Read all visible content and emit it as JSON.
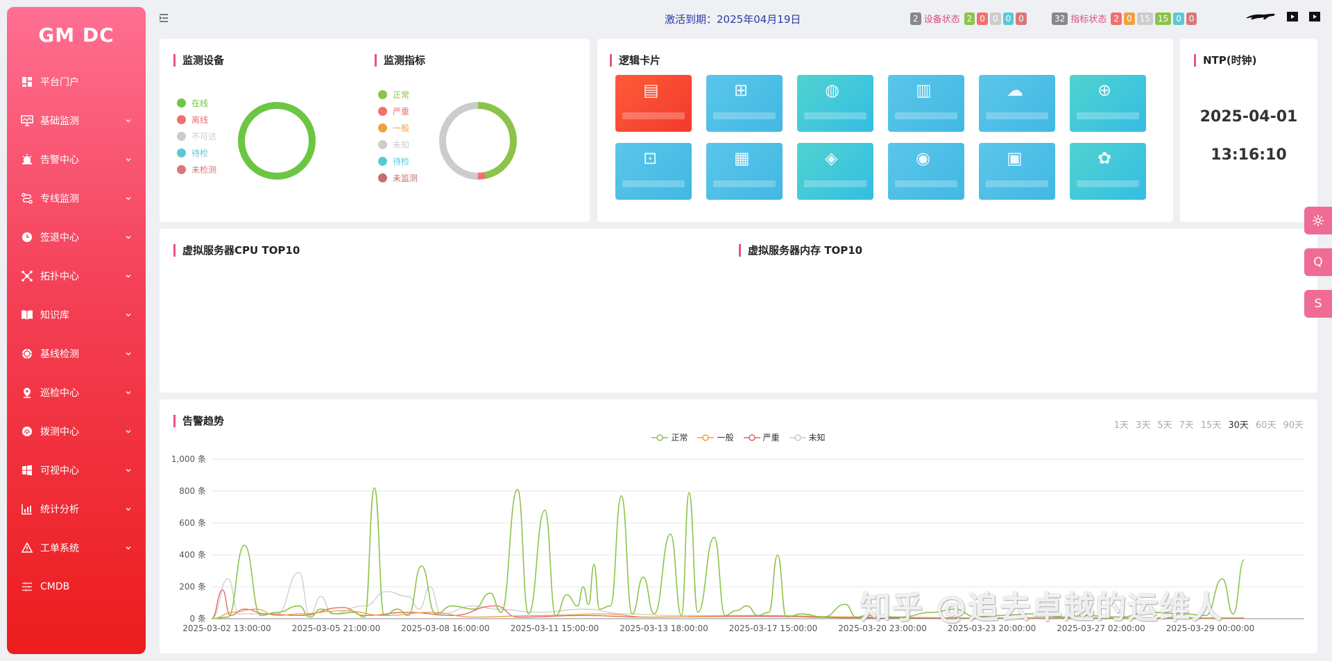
{
  "app": {
    "brand": "GM DC"
  },
  "sidebar": {
    "items": [
      {
        "label": "平台门户",
        "icon": "dashboard-icon",
        "has_children": false
      },
      {
        "label": "基础监测",
        "icon": "monitor-icon",
        "has_children": true
      },
      {
        "label": "告警中心",
        "icon": "alarm-icon",
        "has_children": true
      },
      {
        "label": "专线监测",
        "icon": "route-icon",
        "has_children": true
      },
      {
        "label": "签退中心",
        "icon": "clock-icon",
        "has_children": true
      },
      {
        "label": "拓扑中心",
        "icon": "topology-icon",
        "has_children": true
      },
      {
        "label": "知识库",
        "icon": "book-icon",
        "has_children": true
      },
      {
        "label": "基线检测",
        "icon": "baseline-icon",
        "has_children": true
      },
      {
        "label": "巡检中心",
        "icon": "location-icon",
        "has_children": true
      },
      {
        "label": "拨测中心",
        "icon": "probe-icon",
        "has_children": true
      },
      {
        "label": "可视中心",
        "icon": "windows-icon",
        "has_children": true
      },
      {
        "label": "统计分析",
        "icon": "chart-icon",
        "has_children": true
      },
      {
        "label": "工单系统",
        "icon": "warning-icon",
        "has_children": true
      },
      {
        "label": "CMDB",
        "icon": "sliders-icon",
        "has_children": false
      }
    ]
  },
  "header": {
    "expiry_label": "激活到期：",
    "expiry_date": "2025年04月19日",
    "device_status": {
      "count": "2",
      "label": "设备状态",
      "badges": [
        "2",
        "0",
        "0",
        "0",
        "0"
      ]
    },
    "metric_status": {
      "count": "32",
      "label": "指标状态",
      "badges": [
        "2",
        "0",
        "15",
        "15",
        "0",
        "0"
      ]
    }
  },
  "device_monitor": {
    "title": "监测设备",
    "legend": [
      {
        "label": "在线",
        "color": "#6cc644"
      },
      {
        "label": "离线",
        "color": "#f07070"
      },
      {
        "label": "不可达",
        "color": "#cccccc"
      },
      {
        "label": "待检",
        "color": "#5bc8d6"
      },
      {
        "label": "未检测",
        "color": "#d97878"
      }
    ],
    "values": [
      2,
      0,
      0,
      0,
      0
    ]
  },
  "metric_monitor": {
    "title": "监测指标",
    "legend": [
      {
        "label": "正常",
        "color": "#8cc34a"
      },
      {
        "label": "严重",
        "color": "#f07070"
      },
      {
        "label": "一般",
        "color": "#f0a040"
      },
      {
        "label": "未知",
        "color": "#cccccc"
      },
      {
        "label": "待检",
        "color": "#5bc8d6"
      },
      {
        "label": "未监测",
        "color": "#c07070"
      }
    ],
    "values": [
      15,
      1,
      0,
      16,
      0,
      0
    ]
  },
  "logic_cards": {
    "title": "逻辑卡片",
    "cards": [
      {
        "icon": "server-icon",
        "style": "red"
      },
      {
        "icon": "network-icon",
        "style": "blue"
      },
      {
        "icon": "globe-icon",
        "style": "teal"
      },
      {
        "icon": "storage-icon",
        "style": "blue"
      },
      {
        "icon": "cloud-icon",
        "style": "blue"
      },
      {
        "icon": "lock-icon",
        "style": "teal"
      },
      {
        "icon": "scan-icon",
        "style": "blue"
      },
      {
        "icon": "database-icon",
        "style": "blue"
      },
      {
        "icon": "shield-icon",
        "style": "teal"
      },
      {
        "icon": "display-icon",
        "style": "blue"
      },
      {
        "icon": "vm-icon",
        "style": "blue"
      },
      {
        "icon": "huawei-icon",
        "style": "teal"
      }
    ]
  },
  "ntp": {
    "title": "NTP(时钟)",
    "date": "2025-04-01",
    "time": "13:16:10"
  },
  "top10": {
    "cpu_title": "虚拟服务器CPU TOP10",
    "mem_title": "虚拟服务器内存 TOP10"
  },
  "alert_trend": {
    "title": "告警趋势",
    "ranges": [
      "1天",
      "3天",
      "5天",
      "7天",
      "15天",
      "30天",
      "60天",
      "90天"
    ],
    "active_range": "30天"
  },
  "side_buttons": [
    {
      "label": "",
      "icon": "gear-icon"
    },
    {
      "label": "Q",
      "icon": ""
    },
    {
      "label": "S",
      "icon": ""
    }
  ],
  "watermark": "知乎 @追去卓越的运维人",
  "chart_data": {
    "type": "line",
    "title": "",
    "xlabel": "",
    "ylabel": "",
    "ylim": [
      0,
      1000
    ],
    "y_ticks": [
      "0 条",
      "200 条",
      "400 条",
      "600 条",
      "800 条",
      "1,000 条"
    ],
    "x_ticks": [
      "2025-03-02 13:00:00",
      "2025-03-05 21:00:00",
      "2025-03-08 16:00:00",
      "2025-03-11 15:00:00",
      "2025-03-13 18:00:00",
      "2025-03-17 15:00:00",
      "2025-03-20 23:00:00",
      "2025-03-23 20:00:00",
      "2025-03-27 02:00:00",
      "2025-03-29 00:00:00"
    ],
    "series": [
      {
        "name": "正常",
        "color": "#8cc34a",
        "points": [
          [
            0.0,
            0
          ],
          [
            1.5,
            10
          ],
          [
            3.0,
            460
          ],
          [
            4.5,
            20
          ],
          [
            6,
            40
          ],
          [
            8,
            80
          ],
          [
            9,
            10
          ],
          [
            10,
            60
          ],
          [
            11.5,
            30
          ],
          [
            13,
            40
          ],
          [
            14.0,
            10
          ],
          [
            14.9,
            820
          ],
          [
            15.8,
            20
          ],
          [
            17,
            60
          ],
          [
            18,
            20
          ],
          [
            19.2,
            330
          ],
          [
            20.5,
            30
          ],
          [
            22,
            80
          ],
          [
            24,
            60
          ],
          [
            25.5,
            160
          ],
          [
            26.5,
            40
          ],
          [
            28,
            810
          ],
          [
            29,
            30
          ],
          [
            30.5,
            680
          ],
          [
            31.5,
            20
          ],
          [
            32.5,
            150
          ],
          [
            33.5,
            80
          ],
          [
            34.0,
            200
          ],
          [
            34.5,
            90
          ],
          [
            35,
            340
          ],
          [
            35.5,
            60
          ],
          [
            36.5,
            80
          ],
          [
            37.5,
            770
          ],
          [
            38.5,
            30
          ],
          [
            39.5,
            260
          ],
          [
            40.5,
            30
          ],
          [
            42,
            530
          ],
          [
            43,
            20
          ],
          [
            43.7,
            790
          ],
          [
            44.5,
            40
          ],
          [
            46,
            510
          ],
          [
            47,
            20
          ],
          [
            48,
            50
          ],
          [
            49,
            80
          ],
          [
            50,
            20
          ],
          [
            51,
            40
          ],
          [
            51.8,
            400
          ],
          [
            52.6,
            10
          ],
          [
            54,
            30
          ],
          [
            56,
            10
          ],
          [
            58,
            90
          ],
          [
            59,
            10
          ],
          [
            60,
            20
          ],
          [
            63,
            10
          ],
          [
            66,
            40
          ],
          [
            68,
            60
          ],
          [
            70,
            10
          ],
          [
            72,
            20
          ],
          [
            75,
            30
          ],
          [
            78,
            10
          ],
          [
            80,
            20
          ],
          [
            83,
            10
          ],
          [
            86,
            40
          ],
          [
            89,
            30
          ],
          [
            91,
            20
          ],
          [
            92.5,
            250
          ],
          [
            93.5,
            30
          ],
          [
            94.5,
            370
          ]
        ]
      },
      {
        "name": "一般",
        "color": "#f0a040",
        "points": [
          [
            0,
            0
          ],
          [
            2,
            40
          ],
          [
            4,
            60
          ],
          [
            6,
            20
          ],
          [
            8,
            30
          ],
          [
            12,
            50
          ],
          [
            16,
            20
          ],
          [
            20,
            40
          ],
          [
            24,
            10
          ],
          [
            30,
            20
          ],
          [
            36,
            30
          ],
          [
            40,
            10
          ],
          [
            50,
            20
          ],
          [
            60,
            10
          ],
          [
            70,
            5
          ],
          [
            80,
            5
          ],
          [
            94.5,
            5
          ]
        ]
      },
      {
        "name": "严重",
        "color": "#e06060",
        "points": [
          [
            0,
            0
          ],
          [
            1,
            180
          ],
          [
            1.7,
            20
          ],
          [
            3,
            60
          ],
          [
            5,
            30
          ],
          [
            8,
            20
          ],
          [
            12,
            70
          ],
          [
            14,
            20
          ],
          [
            18,
            40
          ],
          [
            22,
            20
          ],
          [
            26,
            80
          ],
          [
            28,
            10
          ],
          [
            34,
            20
          ],
          [
            40,
            10
          ],
          [
            50,
            15
          ],
          [
            60,
            5
          ],
          [
            70,
            5
          ],
          [
            94.5,
            5
          ]
        ]
      },
      {
        "name": "未知",
        "color": "#cccccc",
        "points": [
          [
            0,
            0
          ],
          [
            1.5,
            250
          ],
          [
            2.5,
            30
          ],
          [
            6,
            30
          ],
          [
            8,
            290
          ],
          [
            9,
            20
          ],
          [
            10,
            140
          ],
          [
            11,
            30
          ],
          [
            14,
            80
          ],
          [
            16,
            170
          ],
          [
            18,
            140
          ],
          [
            19,
            60
          ],
          [
            20,
            200
          ],
          [
            21,
            30
          ],
          [
            24,
            80
          ],
          [
            26,
            60
          ],
          [
            30,
            40
          ],
          [
            34,
            60
          ],
          [
            38,
            30
          ],
          [
            42,
            20
          ],
          [
            50,
            20
          ],
          [
            60,
            10
          ],
          [
            70,
            5
          ],
          [
            80,
            5
          ],
          [
            94.5,
            5
          ]
        ]
      }
    ],
    "x_extent": [
      0,
      100
    ],
    "grid": true,
    "legend_position": "top-center"
  }
}
